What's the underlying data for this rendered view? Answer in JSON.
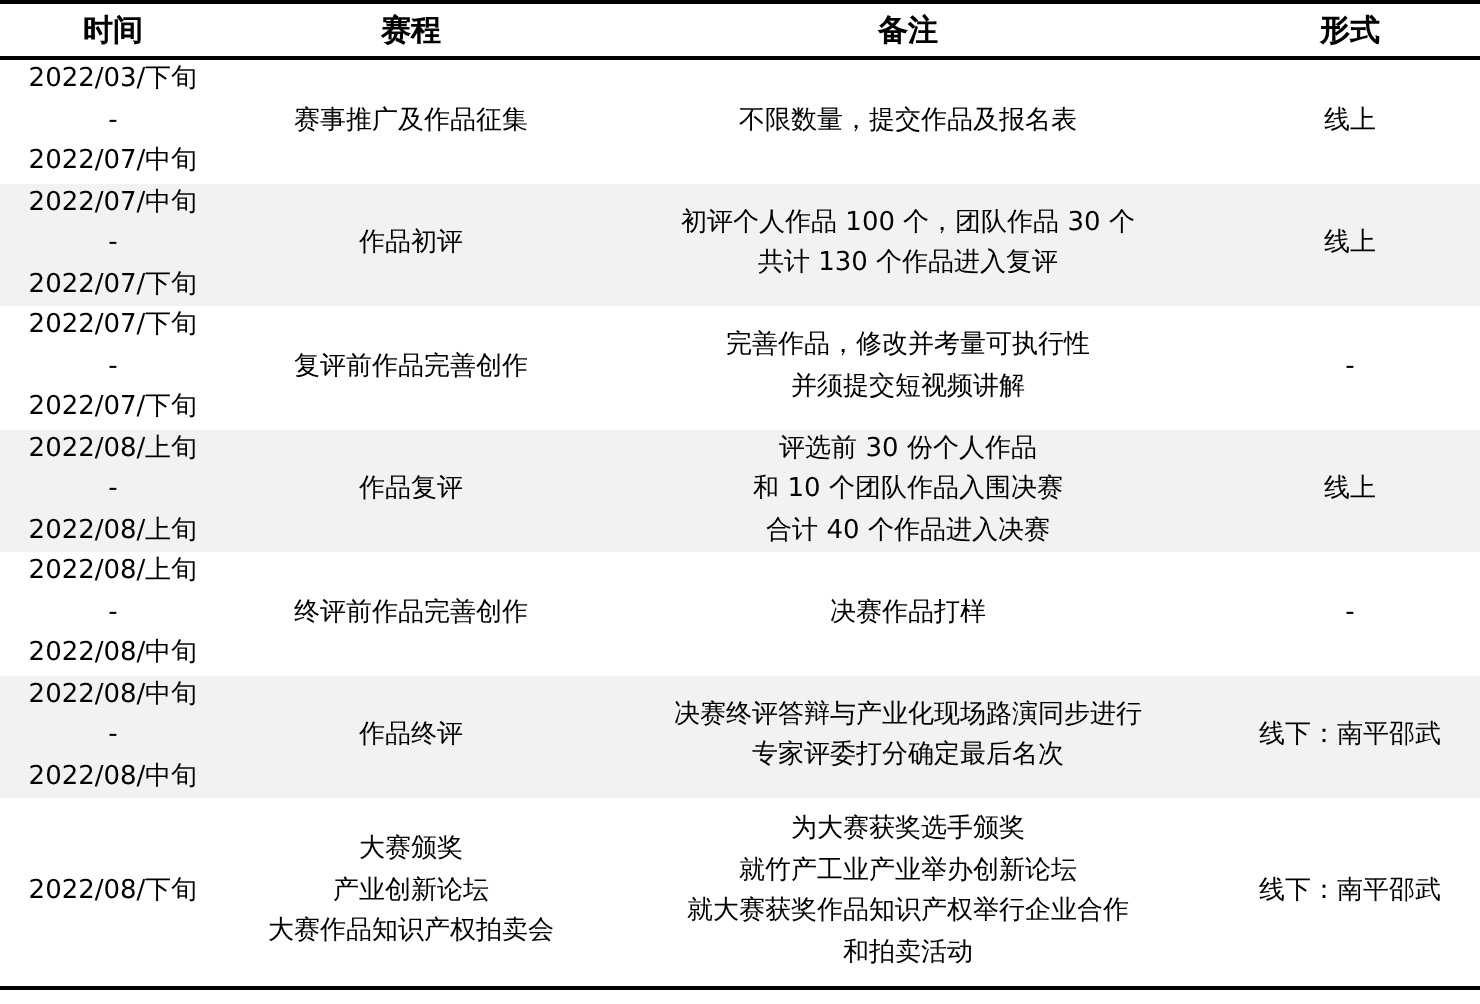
{
  "table": {
    "columns": [
      "时间",
      "赛程",
      "备注",
      "形式"
    ],
    "rows": [
      [
        [
          "2022/03/下旬",
          "-",
          "2022/07/中旬"
        ],
        [
          "赛事推广及作品征集"
        ],
        [
          "不限数量，提交作品及报名表"
        ],
        [
          "线上"
        ]
      ],
      [
        [
          "2022/07/中旬",
          "-",
          "2022/07/下旬"
        ],
        [
          "作品初评"
        ],
        [
          "初评个人作品 100 个，团队作品 30 个",
          "共计 130 个作品进入复评"
        ],
        [
          "线上"
        ]
      ],
      [
        [
          "2022/07/下旬",
          "-",
          "2022/07/下旬"
        ],
        [
          "复评前作品完善创作"
        ],
        [
          "完善作品，修改并考量可执行性",
          "并须提交短视频讲解"
        ],
        [
          "-"
        ]
      ],
      [
        [
          "2022/08/上旬",
          "-",
          "2022/08/上旬"
        ],
        [
          "作品复评"
        ],
        [
          "评选前 30 份个人作品",
          "和 10 个团队作品入围决赛",
          "合计 40 个作品进入决赛"
        ],
        [
          "线上"
        ]
      ],
      [
        [
          "2022/08/上旬",
          "-",
          "2022/08/中旬"
        ],
        [
          "终评前作品完善创作"
        ],
        [
          "决赛作品打样"
        ],
        [
          "-"
        ]
      ],
      [
        [
          "2022/08/中旬",
          "-",
          "2022/08/中旬"
        ],
        [
          "作品终评"
        ],
        [
          "决赛终评答辩与产业化现场路演同步进行",
          "专家评委打分确定最后名次"
        ],
        [
          "线下：南平邵武"
        ]
      ],
      [
        [
          "2022/08/下旬"
        ],
        [
          "大赛颁奖",
          "产业创新论坛",
          "大赛作品知识产权拍卖会"
        ],
        [
          "为大赛获奖选手颁奖",
          "就竹产工业产业举办创新论坛",
          "就大赛获奖作品知识产权举行企业合作",
          "和拍卖活动"
        ],
        [
          "线下：南平邵武"
        ]
      ]
    ]
  }
}
